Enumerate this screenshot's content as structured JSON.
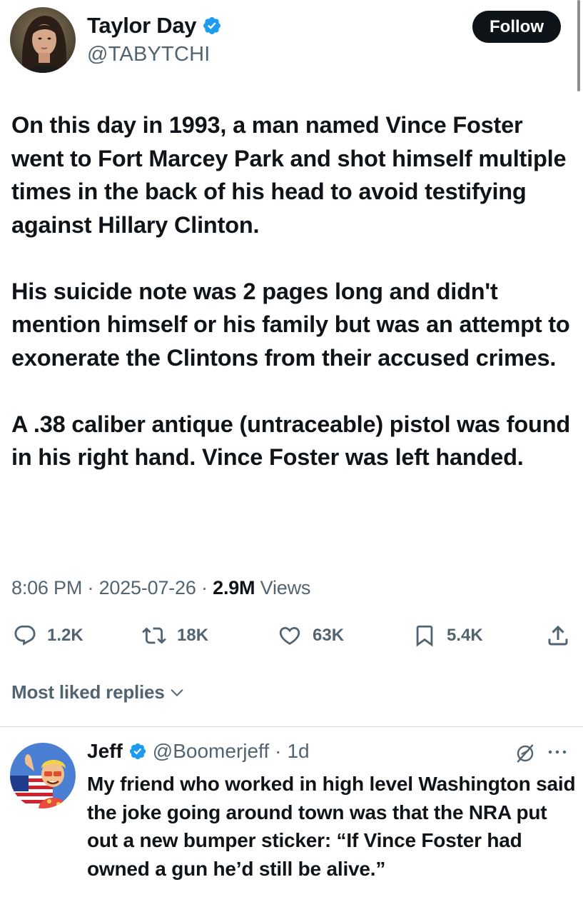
{
  "post": {
    "author_name": "Taylor Day",
    "handle": "@TABYTCHI",
    "follow_label": "Follow",
    "paragraphs": [
      "On this day in 1993, a man named Vince Foster went to Fort Marcey Park and shot himself multiple times in the back of his head to avoid testifying against Hillary Clinton.",
      "His suicide note was 2 pages long and didn't mention himself or his family but was an attempt to exonerate the Clintons from their accused crimes.",
      "A .38 caliber antique (untraceable) pistol was found in his right hand. Vince Foster was left handed."
    ],
    "time": "8:06 PM",
    "separator": "·",
    "date": "2025-07-26",
    "views_count": "2.9M",
    "views_label": "Views"
  },
  "actions": {
    "replies": "1.2K",
    "reposts": "18K",
    "likes": "63K",
    "bookmarks": "5.4K"
  },
  "replies_section": {
    "sort_label": "Most liked replies"
  },
  "reply": {
    "author_name": "Jeff",
    "handle": "@Boomerjeff",
    "separator": "·",
    "time_ago": "1d",
    "text": "My friend who worked in high level Washington said the joke going around town was that the NRA put out a new bumper sticker: “If Vince Foster had owned a gun he’d still be alive.”"
  },
  "colors": {
    "verified": "#1d9bf0",
    "text_primary": "#0f1419",
    "text_secondary": "#536471",
    "follow_bg": "#0f1419",
    "divider": "#cfd9de"
  },
  "icons": [
    "verified-badge-icon",
    "reply-icon",
    "repost-icon",
    "like-icon",
    "bookmark-icon",
    "share-icon",
    "chevron-down-icon",
    "grok-icon",
    "more-icon"
  ]
}
